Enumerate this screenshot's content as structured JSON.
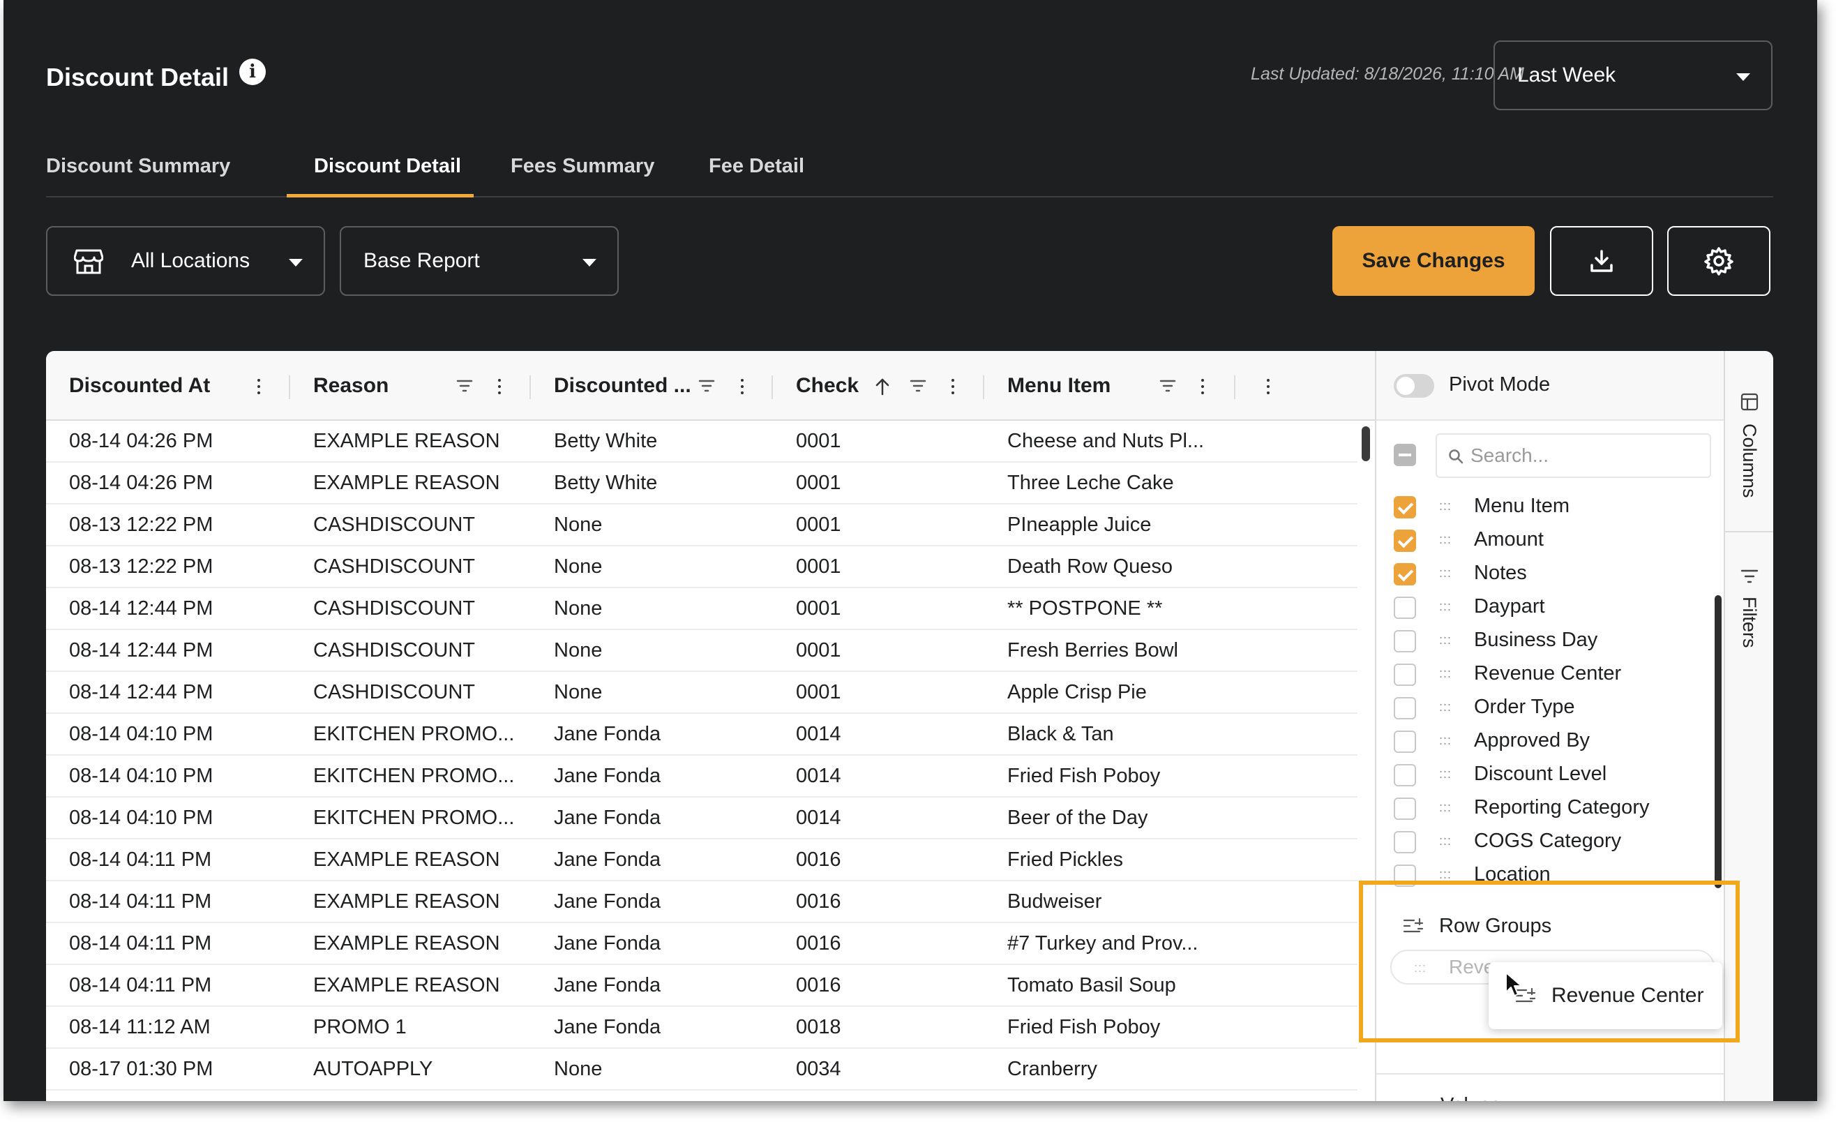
{
  "header": {
    "title": "Discount Detail",
    "info_icon": "info-icon",
    "last_updated": "Last Updated: 8/18/2026, 11:10 AM",
    "period": "Last Week"
  },
  "tabs": [
    {
      "label": "Discount Summary",
      "active": false
    },
    {
      "label": "Discount Detail",
      "active": true
    },
    {
      "label": "Fees Summary",
      "active": false
    },
    {
      "label": "Fee Detail",
      "active": false
    }
  ],
  "toolbar": {
    "location": "All Locations",
    "report": "Base Report",
    "save_label": "Save Changes",
    "download_icon": "download-icon",
    "settings_icon": "gear-icon"
  },
  "grid": {
    "columns": [
      "Discounted At",
      "Reason",
      "Discounted ...",
      "Check",
      "Menu Item"
    ],
    "rows": [
      [
        "08-14 04:26 PM",
        "EXAMPLE REASON",
        "Betty White",
        "0001",
        "Cheese and Nuts Pl..."
      ],
      [
        "08-14 04:26 PM",
        "EXAMPLE REASON",
        "Betty White",
        "0001",
        "Three Leche Cake"
      ],
      [
        "08-13 12:22 PM",
        "CASHDISCOUNT",
        "None",
        "0001",
        "PIneapple Juice"
      ],
      [
        "08-13 12:22 PM",
        "CASHDISCOUNT",
        "None",
        "0001",
        "Death Row Queso"
      ],
      [
        "08-14 12:44 PM",
        "CASHDISCOUNT",
        "None",
        "0001",
        "** POSTPONE **"
      ],
      [
        "08-14 12:44 PM",
        "CASHDISCOUNT",
        "None",
        "0001",
        "Fresh Berries Bowl"
      ],
      [
        "08-14 12:44 PM",
        "CASHDISCOUNT",
        "None",
        "0001",
        "Apple Crisp Pie"
      ],
      [
        "08-14 04:10 PM",
        "EKITCHEN PROMO...",
        "Jane Fonda",
        "0014",
        "Black & Tan"
      ],
      [
        "08-14 04:10 PM",
        "EKITCHEN PROMO...",
        "Jane Fonda",
        "0014",
        "Fried Fish Poboy"
      ],
      [
        "08-14 04:10 PM",
        "EKITCHEN PROMO...",
        "Jane Fonda",
        "0014",
        "Beer of the Day"
      ],
      [
        "08-14 04:11 PM",
        "EXAMPLE REASON",
        "Jane Fonda",
        "0016",
        "Fried Pickles"
      ],
      [
        "08-14 04:11 PM",
        "EXAMPLE REASON",
        "Jane Fonda",
        "0016",
        "Budweiser"
      ],
      [
        "08-14 04:11 PM",
        "EXAMPLE REASON",
        "Jane Fonda",
        "0016",
        "#7 Turkey and Prov..."
      ],
      [
        "08-14 04:11 PM",
        "EXAMPLE REASON",
        "Jane Fonda",
        "0016",
        "Tomato Basil Soup"
      ],
      [
        "08-14 11:12 AM",
        "PROMO 1",
        "Jane Fonda",
        "0018",
        "Fried Fish Poboy"
      ],
      [
        "08-17 01:30 PM",
        "AUTOAPPLY",
        "None",
        "0034",
        "Cranberry"
      ]
    ]
  },
  "side_panel": {
    "pivot_label": "Pivot Mode",
    "pivot_on": false,
    "search_placeholder": "Search...",
    "columns": [
      {
        "label": "Menu Item",
        "checked": true
      },
      {
        "label": "Amount",
        "checked": true
      },
      {
        "label": "Notes",
        "checked": true
      },
      {
        "label": "Daypart",
        "checked": false
      },
      {
        "label": "Business Day",
        "checked": false
      },
      {
        "label": "Revenue Center",
        "checked": false
      },
      {
        "label": "Order Type",
        "checked": false
      },
      {
        "label": "Approved By",
        "checked": false
      },
      {
        "label": "Discount Level",
        "checked": false
      },
      {
        "label": "Reporting Category",
        "checked": false
      },
      {
        "label": "COGS Category",
        "checked": false
      },
      {
        "label": "Location",
        "checked": false
      }
    ],
    "row_groups_title": "Row Groups",
    "row_group_chip": "Reven",
    "drag_ghost_label": "Revenue Center",
    "values_label": "Values",
    "side_tabs": [
      "Columns",
      "Filters"
    ]
  },
  "colors": {
    "accent": "#eea23a",
    "highlight": "#f2a81d",
    "background": "#1d1f21"
  }
}
